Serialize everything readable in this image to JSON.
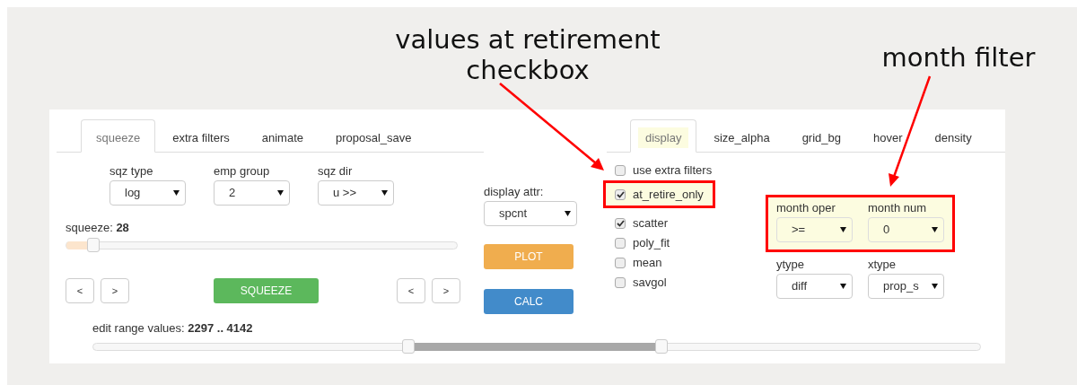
{
  "annotations": [
    {
      "lines": [
        "values at retirement",
        "checkbox"
      ]
    },
    {
      "lines": [
        "month filter"
      ]
    }
  ],
  "left_tabs": [
    {
      "label": "squeeze",
      "selected": true
    },
    {
      "label": "extra filters",
      "selected": false
    },
    {
      "label": "animate",
      "selected": false
    },
    {
      "label": "proposal_save",
      "selected": false
    }
  ],
  "selects": [
    {
      "label": "sqz type",
      "value": "log"
    },
    {
      "label": "emp group",
      "value": "2"
    },
    {
      "label": "sqz dir",
      "value": "u >>"
    }
  ],
  "squeeze": {
    "label": "squeeze:",
    "value": "28",
    "level": 0.07
  },
  "left_nav": [
    {
      "label": "<"
    },
    {
      "label": ">"
    }
  ],
  "squeeze_button": {
    "label": "SQUEEZE",
    "kind": "success"
  },
  "right_nav": [
    {
      "label": "<"
    },
    {
      "label": ">"
    }
  ],
  "display_attr": {
    "label": "display attr:",
    "value": "spcnt"
  },
  "action_buttons": [
    {
      "label": "PLOT",
      "kind": "warning"
    },
    {
      "label": "CALC",
      "kind": "primary"
    }
  ],
  "right_tabs": [
    {
      "label": "display",
      "selected": true
    },
    {
      "label": "size_alpha",
      "selected": false
    },
    {
      "label": "grid_bg",
      "selected": false
    },
    {
      "label": "hover",
      "selected": false
    },
    {
      "label": "density",
      "selected": false
    }
  ],
  "checkboxes": [
    {
      "label": "use extra filters",
      "checked": false,
      "highlighted": false
    },
    {
      "label": "at_retire_only",
      "checked": true,
      "highlighted": true
    },
    {
      "label": "scatter",
      "checked": true,
      "highlighted": false
    },
    {
      "label": "poly_fit",
      "checked": false,
      "highlighted": false
    },
    {
      "label": "mean",
      "checked": false,
      "highlighted": false
    },
    {
      "label": "savgol",
      "checked": false,
      "highlighted": false
    }
  ],
  "month_filter": {
    "highlighted": true,
    "selects": [
      {
        "label": "month oper",
        "value": ">="
      },
      {
        "label": "month num",
        "value": "0"
      }
    ]
  },
  "type_selects": [
    {
      "label": "ytype",
      "value": "diff"
    },
    {
      "label": "xtype",
      "value": "prop_s"
    }
  ],
  "range": {
    "label": "edit range values:",
    "value": "2297 .. 4142",
    "thumbs": [
      {
        "level": 0.355
      },
      {
        "level": 0.641
      }
    ]
  }
}
